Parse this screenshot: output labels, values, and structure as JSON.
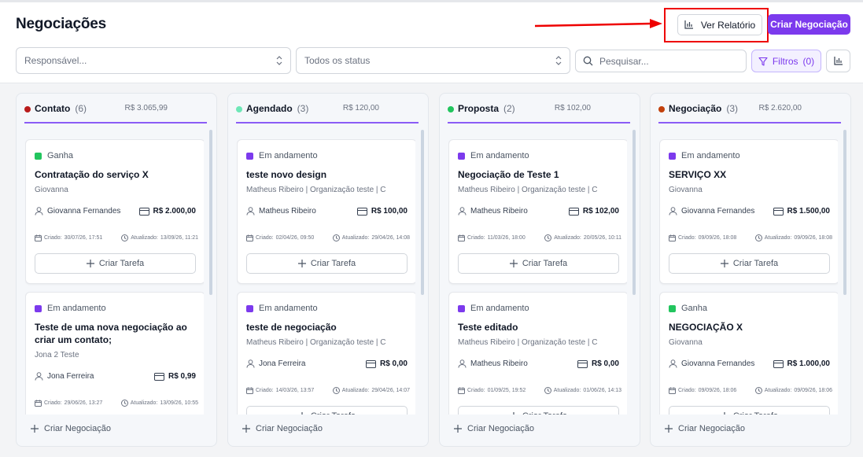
{
  "header": {
    "title": "Negociações",
    "report_button": "Ver Relatório",
    "create_button": "Criar Negociação"
  },
  "filters": {
    "responsible_placeholder": "Responsável...",
    "status_value": "Todos os status",
    "search_placeholder": "Pesquisar...",
    "filter_button": "Filtros",
    "filter_count": "(0)"
  },
  "labels": {
    "created": "Criado:",
    "updated": "Atualizado:",
    "create_task": "Criar Tarefa",
    "add_deal": "Criar Negociação"
  },
  "colors": {
    "accent": "#7c3aed",
    "won": "#22c55e",
    "in_progress": "#7c3aed"
  },
  "columns": [
    {
      "name": "Contato",
      "count": "(6)",
      "total": "R$ 3.065,99",
      "dot_color": "#b91c1c",
      "cards": [
        {
          "status": "Ganha",
          "status_color": "#22c55e",
          "title": "Contratação do serviço X",
          "subtitle": "Giovanna",
          "owner": "Giovanna Fernandes",
          "value": "R$ 2.000,00",
          "created": "30/07/26, 17:51",
          "updated": "13/09/26, 11:21"
        },
        {
          "status": "Em andamento",
          "status_color": "#7c3aed",
          "title": "Teste de uma nova negociação ao criar um contato;",
          "subtitle": "Jona 2 Teste",
          "owner": "Jona Ferreira",
          "value": "R$ 0,99",
          "created": "29/06/26, 13:27",
          "updated": "13/09/26, 10:55"
        }
      ]
    },
    {
      "name": "Agendado",
      "count": "(3)",
      "total": "R$ 120,00",
      "dot_color": "#6ee7b7",
      "cards": [
        {
          "status": "Em andamento",
          "status_color": "#7c3aed",
          "title": "teste novo design",
          "subtitle": "Matheus Ribeiro | Organização teste | C",
          "owner": "Matheus Ribeiro",
          "value": "R$ 100,00",
          "created": "02/04/26, 09:50",
          "updated": "29/04/26, 14:08"
        },
        {
          "status": "Em andamento",
          "status_color": "#7c3aed",
          "title": "teste de negociação",
          "subtitle": "Matheus Ribeiro | Organização teste | C",
          "owner": "Jona Ferreira",
          "value": "R$ 0,00",
          "created": "14/03/26, 13:57",
          "updated": "29/04/26, 14:07"
        }
      ]
    },
    {
      "name": "Proposta",
      "count": "(2)",
      "total": "R$ 102,00",
      "dot_color": "#22c55e",
      "cards": [
        {
          "status": "Em andamento",
          "status_color": "#7c3aed",
          "title": "Negociação de Teste 1",
          "subtitle": "Matheus Ribeiro | Organização teste | C",
          "owner": "Matheus Ribeiro",
          "value": "R$ 102,00",
          "created": "11/03/26, 18:00",
          "updated": "20/05/26, 10:11"
        },
        {
          "status": "Em andamento",
          "status_color": "#7c3aed",
          "title": "Teste editado",
          "subtitle": "Matheus Ribeiro | Organização teste | C",
          "owner": "Matheus Ribeiro",
          "value": "R$ 0,00",
          "created": "01/09/25, 19:52",
          "updated": "01/06/26, 14:13"
        }
      ]
    },
    {
      "name": "Negociação",
      "count": "(3)",
      "total": "R$ 2.620,00",
      "dot_color": "#c2410c",
      "cards": [
        {
          "status": "Em andamento",
          "status_color": "#7c3aed",
          "title": "SERVIÇO XX",
          "subtitle": "Giovanna",
          "owner": "Giovanna Fernandes",
          "value": "R$ 1.500,00",
          "created": "09/09/26, 18:08",
          "updated": "09/09/26, 18:08"
        },
        {
          "status": "Ganha",
          "status_color": "#22c55e",
          "title": "NEGOCIAÇÃO X",
          "subtitle": "Giovanna",
          "owner": "Giovanna Fernandes",
          "value": "R$ 1.000,00",
          "created": "09/09/26, 18:06",
          "updated": "09/09/26, 18:06"
        }
      ]
    }
  ]
}
